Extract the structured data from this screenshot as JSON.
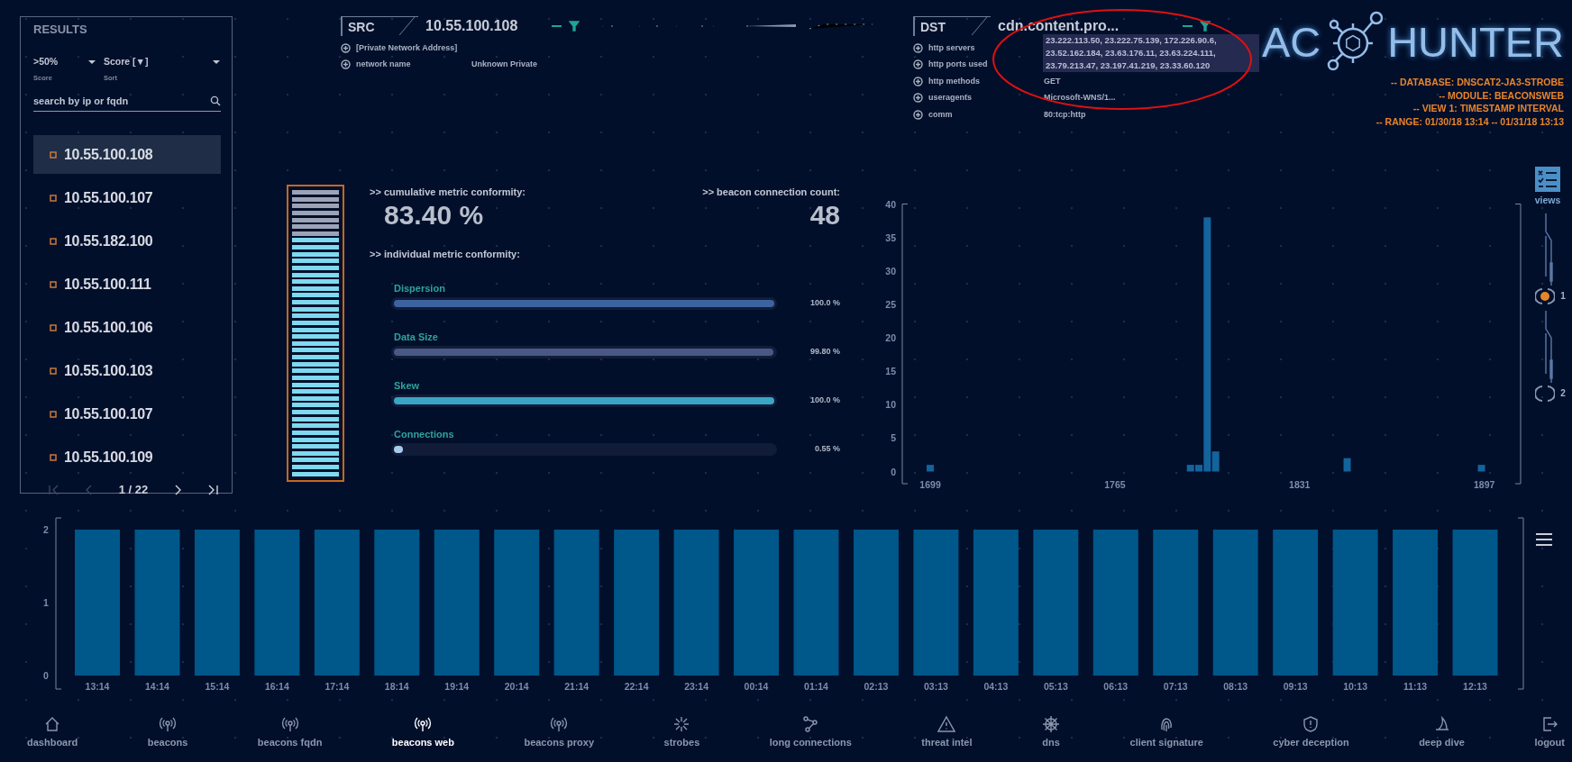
{
  "results": {
    "title": "RESULTS",
    "filters": [
      {
        "value": ">50%",
        "label": "Score"
      },
      {
        "value": "Score [▼]",
        "label": "Sort"
      }
    ],
    "search": {
      "placeholder": "search by ip or fqdn"
    },
    "items": [
      {
        "ip": "10.55.100.108",
        "selected": true
      },
      {
        "ip": "10.55.100.107",
        "selected": false
      },
      {
        "ip": "10.55.182.100",
        "selected": false
      },
      {
        "ip": "10.55.100.111",
        "selected": false
      },
      {
        "ip": "10.55.100.106",
        "selected": false
      },
      {
        "ip": "10.55.100.103",
        "selected": false
      },
      {
        "ip": "10.55.100.107",
        "selected": false
      },
      {
        "ip": "10.55.100.109",
        "selected": false
      }
    ],
    "pager": [
      {
        "kind": "first",
        "disabled": true
      },
      {
        "kind": "prev",
        "disabled": true
      },
      {
        "kind": "page",
        "text": "1 / 22"
      },
      {
        "kind": "next",
        "disabled": false
      },
      {
        "kind": "last",
        "disabled": false
      }
    ]
  },
  "src": {
    "label": "SRC",
    "value": "10.55.100.108",
    "details": [
      {
        "label": "[Private Network Address]",
        "kind": "text"
      },
      {
        "label": "network name",
        "value": "Unknown Private",
        "kind": "text"
      }
    ]
  },
  "dst": {
    "label": "DST",
    "value": "cdn.content.pro...",
    "details": [
      {
        "label": "http servers",
        "value": "23.222.113.50, 23.222.75.139, 172.226.90.6, 23.52.162.184, 23.63.176.11, 23.63.224.111, 23.79.213.47, 23.197.41.219, 23.33.60.120",
        "kind": "list"
      },
      {
        "label": "http ports used",
        "kind": "text"
      },
      {
        "label": "http methods",
        "value": "GET",
        "kind": "text"
      },
      {
        "label": "useragents",
        "value": "Microsoft-WNS/1...",
        "kind": "text"
      },
      {
        "label": "comm",
        "value": "80:tcp:http",
        "kind": "text"
      }
    ]
  },
  "logo": {
    "left": "AC",
    "right": "HUNTER"
  },
  "info": [
    "-- DATABASE: DNSCAT2-JA3-STROBE",
    "-- MODULE: BEACONSWEB",
    "-- VIEW 1: TIMESTAMP INTERVAL",
    "-- RANGE: 01/30/18 13:14 -- 01/31/18 13:13"
  ],
  "gauge": {
    "level": 0.834
  },
  "summary": {
    "conformity_label": ">> cumulative metric conformity:",
    "conformity": "83.40 %",
    "count_label": ">> beacon connection count:",
    "count": "48",
    "individual_label": ">> individual metric conformity:"
  },
  "metrics": [
    {
      "name": "Dispersion",
      "level": 1.0,
      "reading": "100.0 %",
      "color": "#3d62a0"
    },
    {
      "name": "Data Size",
      "level": 0.998,
      "reading": "99.80 %",
      "color": "#4a5886"
    },
    {
      "name": "Skew",
      "level": 1.0,
      "reading": "100.0 %",
      "color": "#3ba5c6"
    },
    {
      "name": "Connections",
      "level": 0.0055,
      "reading": "0.55 %",
      "color": "#a9c8ec"
    }
  ],
  "histogram": {
    "chart_data": {
      "type": "bar",
      "x": [
        1699,
        1792,
        1795,
        1798,
        1801,
        1848,
        1896
      ],
      "values": [
        1,
        1,
        1,
        38,
        3,
        2,
        1
      ],
      "xlim": [
        1689,
        1910
      ],
      "ylim": [
        0,
        40
      ],
      "xticks": [
        1699,
        1765,
        1831,
        1897
      ],
      "yticks": [
        0,
        5,
        10,
        15,
        20,
        25,
        30,
        35,
        40
      ]
    }
  },
  "views": {
    "label": "views",
    "steps": [
      {
        "label": "1",
        "selected": true
      },
      {
        "label": "2",
        "selected": false
      }
    ]
  },
  "timeline": {
    "chart_data": {
      "type": "bar",
      "categories": [
        "13:14",
        "14:14",
        "15:14",
        "16:14",
        "17:14",
        "18:14",
        "19:14",
        "20:14",
        "21:14",
        "22:14",
        "23:14",
        "00:14",
        "01:14",
        "02:13",
        "03:13",
        "04:13",
        "05:13",
        "06:13",
        "07:13",
        "08:13",
        "09:13",
        "10:13",
        "11:13",
        "12:13"
      ],
      "values": [
        2,
        2,
        2,
        2,
        2,
        2,
        2,
        2,
        2,
        2,
        2,
        2,
        2,
        2,
        2,
        2,
        2,
        2,
        2,
        2,
        2,
        2,
        2,
        2
      ],
      "ylim": [
        0,
        2
      ],
      "yticks": [
        0,
        1,
        2
      ]
    }
  },
  "nav": [
    {
      "label": "dashboard",
      "kind": "home",
      "selected": false
    },
    {
      "label": "beacons",
      "kind": "antenna",
      "selected": false
    },
    {
      "label": "beacons fqdn",
      "kind": "antenna",
      "selected": false
    },
    {
      "label": "beacons web",
      "kind": "antenna",
      "selected": true
    },
    {
      "label": "beacons proxy",
      "kind": "antenna",
      "selected": false
    },
    {
      "label": "strobes",
      "kind": "burst",
      "selected": false
    },
    {
      "label": "long connections",
      "kind": "nodes",
      "selected": false
    },
    {
      "label": "threat intel",
      "kind": "warning",
      "selected": false
    },
    {
      "label": "dns",
      "kind": "wheel",
      "selected": false
    },
    {
      "label": "client signature",
      "kind": "fingerprint",
      "selected": false
    },
    {
      "label": "cyber deception",
      "kind": "shield",
      "selected": false
    },
    {
      "label": "deep dive",
      "kind": "fin",
      "selected": false
    },
    {
      "label": "logout",
      "kind": "logout",
      "selected": false
    }
  ]
}
